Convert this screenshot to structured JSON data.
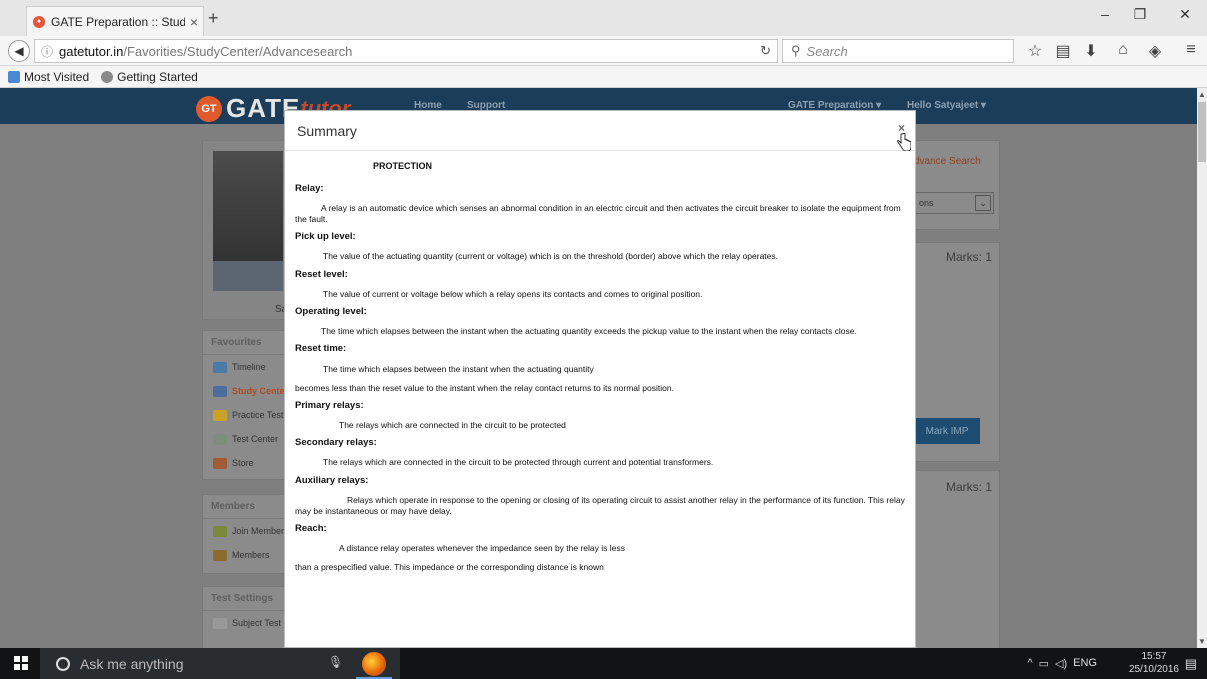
{
  "browser": {
    "tab_title": "GATE Preparation :: Study ...",
    "tab_close": "×",
    "new_tab": "+",
    "window_min": "–",
    "window_max": "❐",
    "window_close": "✕",
    "url_info": "ⓘ",
    "url_domain": "gatetutor.in",
    "url_path": "/Favorities/StudyCenter/Advancesearch",
    "reload": "↻",
    "search_placeholder": "Search",
    "bookmarks": [
      "Most Visited",
      "Getting Started"
    ]
  },
  "site": {
    "logo_text": "GATE",
    "logo_tutor": "tutor",
    "logo_badge": "GT",
    "nav": [
      "Home",
      "Support"
    ],
    "nav_right": [
      "GATE Preparation ▾",
      "Hello Satyajeet ▾"
    ]
  },
  "sidebar": {
    "profile_name_fragment": "Sa",
    "favourites_title": "Favourites",
    "favourites": [
      {
        "label": "Timeline",
        "icon": "timeline-icon",
        "color": "#4a7aa8"
      },
      {
        "label": "Study Center",
        "icon": "books-icon",
        "color": "#4b6d9c",
        "active": true
      },
      {
        "label": "Practice Test",
        "icon": "folder-icon",
        "color": "#c9a227"
      },
      {
        "label": "Test Center",
        "icon": "test-icon",
        "color": "#7d8e7d"
      },
      {
        "label": "Store",
        "icon": "store-icon",
        "color": "#a25c35"
      }
    ],
    "members_title": "Members",
    "members": [
      {
        "label": "Join Members",
        "icon": "join-members-icon",
        "color": "#7a8a3a"
      },
      {
        "label": "Members",
        "icon": "members-icon",
        "color": "#8c6b2f"
      }
    ],
    "test_settings_title": "Test Settings",
    "test_settings": [
      {
        "label": "Subject Test",
        "icon": "pencil-icon",
        "color": "#999999"
      }
    ]
  },
  "right": {
    "advance_search": "dvance Search",
    "select_value": "ons",
    "marks_1": "Marks: 1",
    "marks_2": "Marks: 1",
    "mark_imp": "Mark IMP"
  },
  "modal": {
    "title": "Summary",
    "close": "×",
    "heading": "PROTECTION",
    "entries": [
      {
        "term": "Relay:",
        "defs": [
          "A relay is an automatic device which senses an abnormal condition in an electric circuit and then activates the circuit breaker to isolate the equipment from the fault."
        ]
      },
      {
        "term": "Pick up level:",
        "defs": [
          "The value of the actuating quantity (current or voltage) which is on the threshold (border) above which the relay operates."
        ]
      },
      {
        "term": "Reset level:",
        "defs": [
          "The value of current or voltage below which a relay opens its contacts and comes to original position."
        ]
      },
      {
        "term": "Operating level:",
        "defs": [
          "The time which elapses between the instant when the actuating quantity exceeds the pickup value to the instant when the relay contacts close."
        ]
      },
      {
        "term": "Reset time:",
        "defs": [
          "The time which elapses between the instant when the actuating quantity",
          "becomes less than the reset value to the instant when the relay contact returns to its normal position."
        ]
      },
      {
        "term": "Primary relays:",
        "defs": [
          "The relays which are connected in the circuit to be protected"
        ]
      },
      {
        "term": "Secondary relays:",
        "defs": [
          "The relays which are connected in the circuit to be protected through current and potential transformers."
        ]
      },
      {
        "term": "Auxiliary relays:",
        "defs": [
          "Relays which operate in response to the opening or closing of its operating circuit to assist another relay in the performance of its function. This relay may be instantaneous or may have delay."
        ]
      },
      {
        "term": "Reach:",
        "defs": [
          "A distance relay operates whenever the impedance seen by the relay is less",
          "than a prespecified value. This impedance or the corresponding distance is known"
        ]
      }
    ]
  },
  "taskbar": {
    "search_text": "Ask me anything",
    "tray_lang": "ENG",
    "time": "15:57",
    "date": "25/10/2016"
  }
}
